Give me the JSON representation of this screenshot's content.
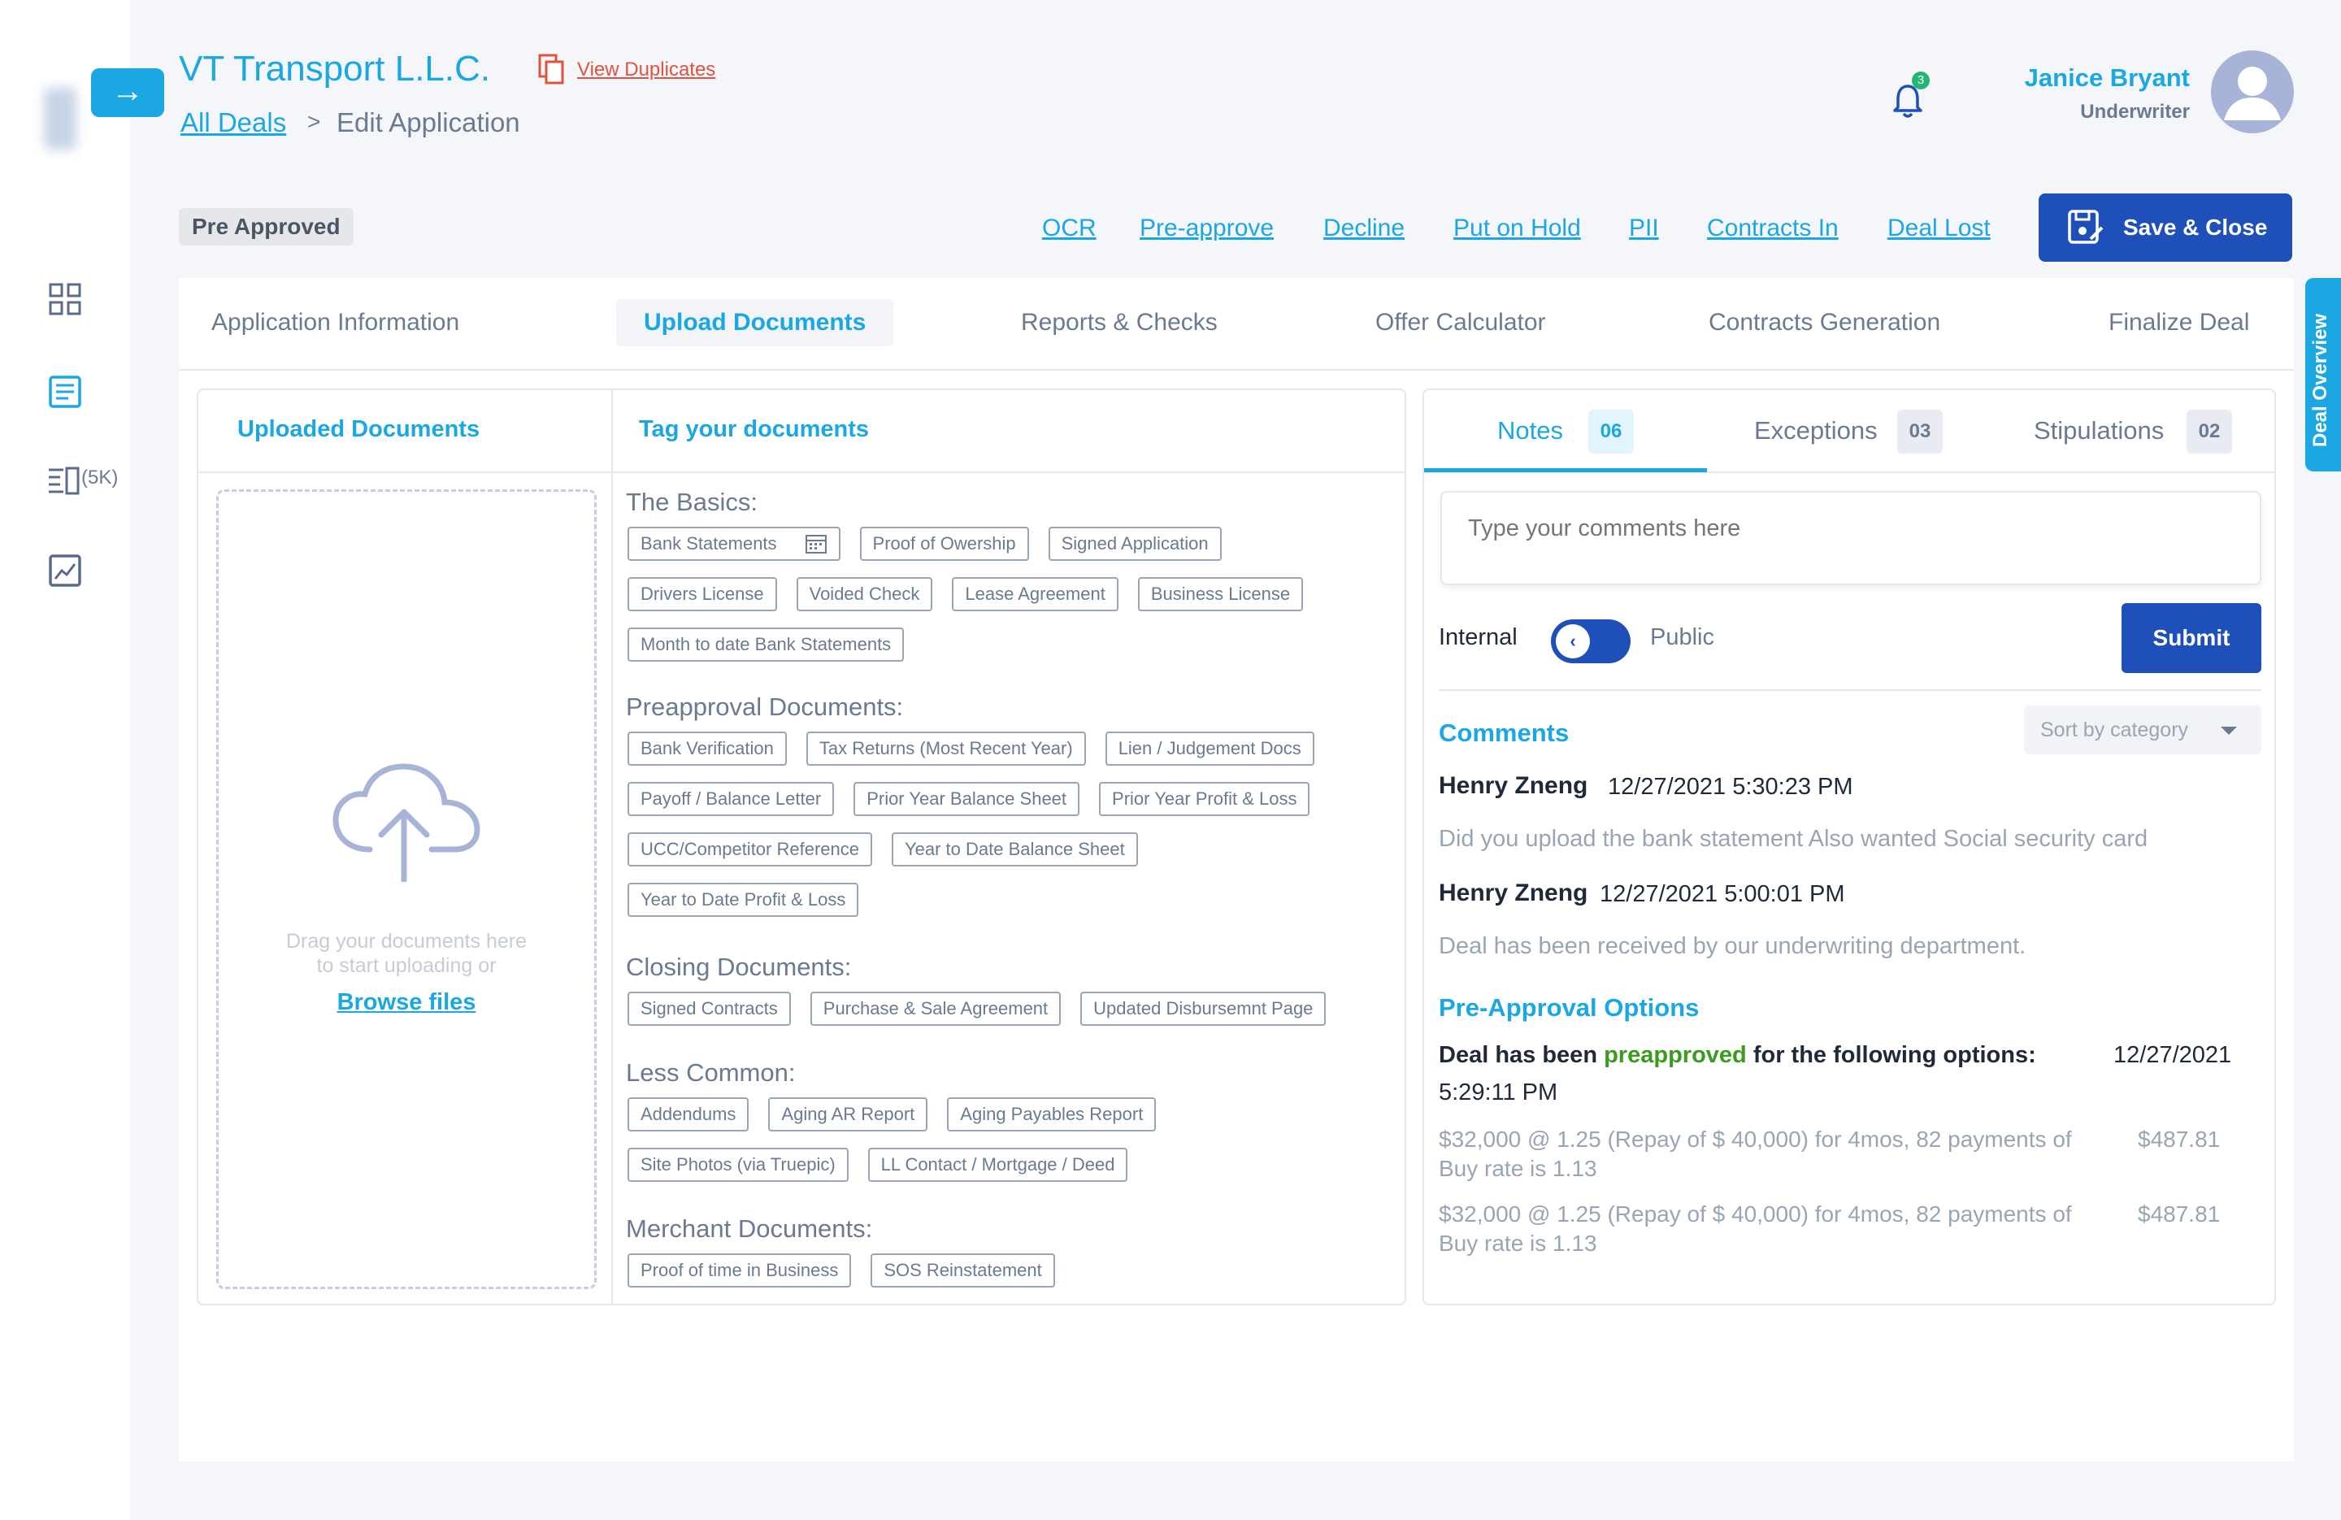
{
  "header": {
    "company": "VT Transport L.L.C.",
    "view_duplicates": "View Duplicates",
    "breadcrumb_link": "All Deals",
    "breadcrumb_sep": ">",
    "breadcrumb_current": "Edit Application",
    "notification_count": "3",
    "user_name": "Janice Bryant",
    "user_role": "Underwriter"
  },
  "sidebar": {
    "toggle_glyph": "→",
    "list_count": "(5K)"
  },
  "status": "Pre Approved",
  "actions": [
    "OCR",
    "Pre-approve",
    "Decline",
    "Put on Hold",
    "PII",
    "Contracts In",
    "Deal Lost"
  ],
  "save_close": "Save & Close",
  "deal_overview": "Deal Overview",
  "tabs": [
    "Application Information",
    "Upload Documents",
    "Reports & Checks",
    "Offer Calculator",
    "Contracts Generation",
    "Finalize Deal"
  ],
  "upload": {
    "uploaded_title": "Uploaded Documents",
    "tag_title": "Tag your documents",
    "drop_line1": "Drag your documents here",
    "drop_line2": "to start uploading or",
    "browse": "Browse files",
    "sections": [
      {
        "title": "The Basics:",
        "rows": [
          [
            "Bank Statements",
            "Proof of Owership",
            "Signed Application"
          ],
          [
            "Drivers License",
            "Voided Check",
            "Lease Agreement",
            "Business License"
          ],
          [
            "Month to date Bank Statements"
          ]
        ]
      },
      {
        "title": "Preapproval Documents:",
        "rows": [
          [
            "Bank Verification",
            "Tax Returns (Most Recent Year)",
            "Lien / Judgement Docs"
          ],
          [
            "Payoff / Balance Letter",
            "Prior Year Balance Sheet",
            "Prior Year Profit & Loss"
          ],
          [
            "UCC/Competitor Reference",
            "Year to Date Balance Sheet"
          ],
          [
            "Year to Date Profit & Loss"
          ]
        ]
      },
      {
        "title": "Closing Documents:",
        "rows": [
          [
            "Signed Contracts",
            "Purchase & Sale Agreement",
            "Updated Disbursemnt Page"
          ]
        ]
      },
      {
        "title": "Less Common:",
        "rows": [
          [
            "Addendums",
            "Aging AR Report",
            "Aging Payables Report"
          ],
          [
            "Site Photos (via Truepic)",
            "LL Contact / Mortgage / Deed"
          ]
        ]
      },
      {
        "title": "Merchant Documents:",
        "rows": [
          [
            "Proof of time in Business",
            "SOS Reinstatement"
          ]
        ]
      }
    ]
  },
  "notes": {
    "tabs": [
      {
        "label": "Notes",
        "count": "06"
      },
      {
        "label": "Exceptions",
        "count": "03"
      },
      {
        "label": "Stipulations",
        "count": "02"
      }
    ],
    "placeholder": "Type your comments here",
    "internal": "Internal",
    "public": "Public",
    "toggle_glyph": "‹",
    "submit": "Submit",
    "comments_title": "Comments",
    "sort_label": "Sort by category",
    "comments": [
      {
        "author": "Henry Zneng",
        "date": "12/27/2021  5:30:23 PM",
        "text": "Did you upload the bank statement  Also wanted Social security card"
      },
      {
        "author": "Henry Zneng",
        "date": "12/27/2021    5:00:01 PM",
        "text": "Deal has been received by our underwriting department."
      }
    ],
    "preapproval_title": "Pre-Approval Options",
    "pa_prefix": "Deal has been ",
    "pa_highlight": "preapproved",
    "pa_suffix": " for the following options:",
    "pa_date": "12/27/2021",
    "pa_time": "5:29:11 PM",
    "options": [
      {
        "line": "$32,000 @ 1.25 (Repay of $ 40,000) for 4mos, 82 payments of",
        "amount": "$487.81",
        "buy_rate": "Buy rate is 1.13"
      },
      {
        "line": "$32,000 @ 1.25 (Repay of $ 40,000) for 4mos, 82 payments of",
        "amount": "$487.81",
        "buy_rate": "Buy rate is 1.13"
      }
    ]
  },
  "colors": {
    "accent": "#1ba7e2",
    "primary_button": "#1f4fb8",
    "duplicate_link": "#e0533e",
    "approved_green": "#3a9b1f"
  }
}
